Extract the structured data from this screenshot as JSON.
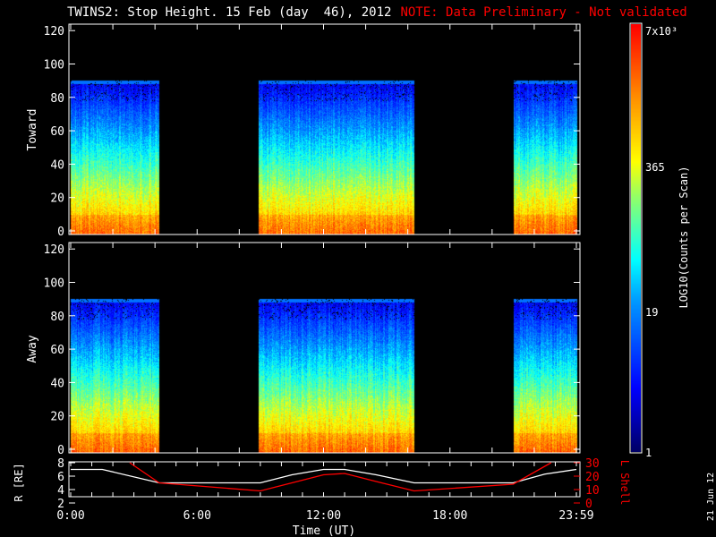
{
  "title": "TWINS2: Stop Height. 15 Feb (day  46), 2012",
  "note": "NOTE: Data Preliminary - Not validated",
  "date_stamp": "21 Jun 12",
  "colors": {
    "note": "#ff0000",
    "r_line": "#ffffff",
    "l_line": "#ff0000"
  },
  "chart_data": [
    {
      "type": "heatmap",
      "panel": "Toward",
      "ylabel": "Toward",
      "ylim": [
        0,
        126
      ],
      "yticks": [
        "0",
        "20",
        "40",
        "60",
        "80",
        "100",
        "120"
      ],
      "xlim_hours": [
        0,
        24
      ],
      "data_intervals_hours": [
        [
          0,
          4.2
        ],
        [
          8.9,
          16.3
        ],
        [
          21.0,
          24
        ]
      ],
      "max_height": 92,
      "sub_block_break_hours": 11.0
    },
    {
      "type": "heatmap",
      "panel": "Away",
      "ylabel": "Away",
      "ylim": [
        0,
        126
      ],
      "yticks": [
        "0",
        "20",
        "40",
        "60",
        "80",
        "100",
        "120"
      ],
      "xlim_hours": [
        0,
        24
      ],
      "data_intervals_hours": [
        [
          0,
          4.2
        ],
        [
          8.9,
          16.3
        ],
        [
          21.0,
          24
        ]
      ],
      "max_height": 92,
      "sub_block_break_hours": 11.0
    },
    {
      "type": "line",
      "panel": "orbit",
      "ylabel": "R [RE]",
      "ylabel_right": "L Shell",
      "ylim": [
        2,
        8
      ],
      "ylim_right": [
        0,
        30
      ],
      "yticks": [
        "2",
        "4",
        "6",
        "8"
      ],
      "yticks_right": [
        "0",
        "10",
        "20",
        "30"
      ],
      "xlabel": "Time (UT)",
      "xticks": [
        "0:00",
        "6:00",
        "12:00",
        "18:00",
        "23:59"
      ],
      "series": [
        {
          "name": "R",
          "x": [
            0,
            1.5,
            4.2,
            9,
            10.5,
            12,
            13,
            14.5,
            16.3,
            21,
            22.5,
            24
          ],
          "y": [
            7,
            7,
            5,
            5,
            6.2,
            7,
            7,
            6.2,
            5,
            5,
            6.3,
            7
          ]
        },
        {
          "name": "L Shell",
          "x": [
            2.8,
            4.2,
            9,
            10.5,
            12,
            13,
            14.5,
            16.3,
            21,
            22.8
          ],
          "y": [
            30,
            15,
            9,
            15,
            21,
            22,
            16,
            9,
            14,
            30
          ]
        }
      ]
    },
    {
      "type": "colorbar",
      "label": "LOG10(Counts per Scan)",
      "ticks": [
        "1",
        "19",
        "365",
        "7x10^3"
      ]
    }
  ]
}
